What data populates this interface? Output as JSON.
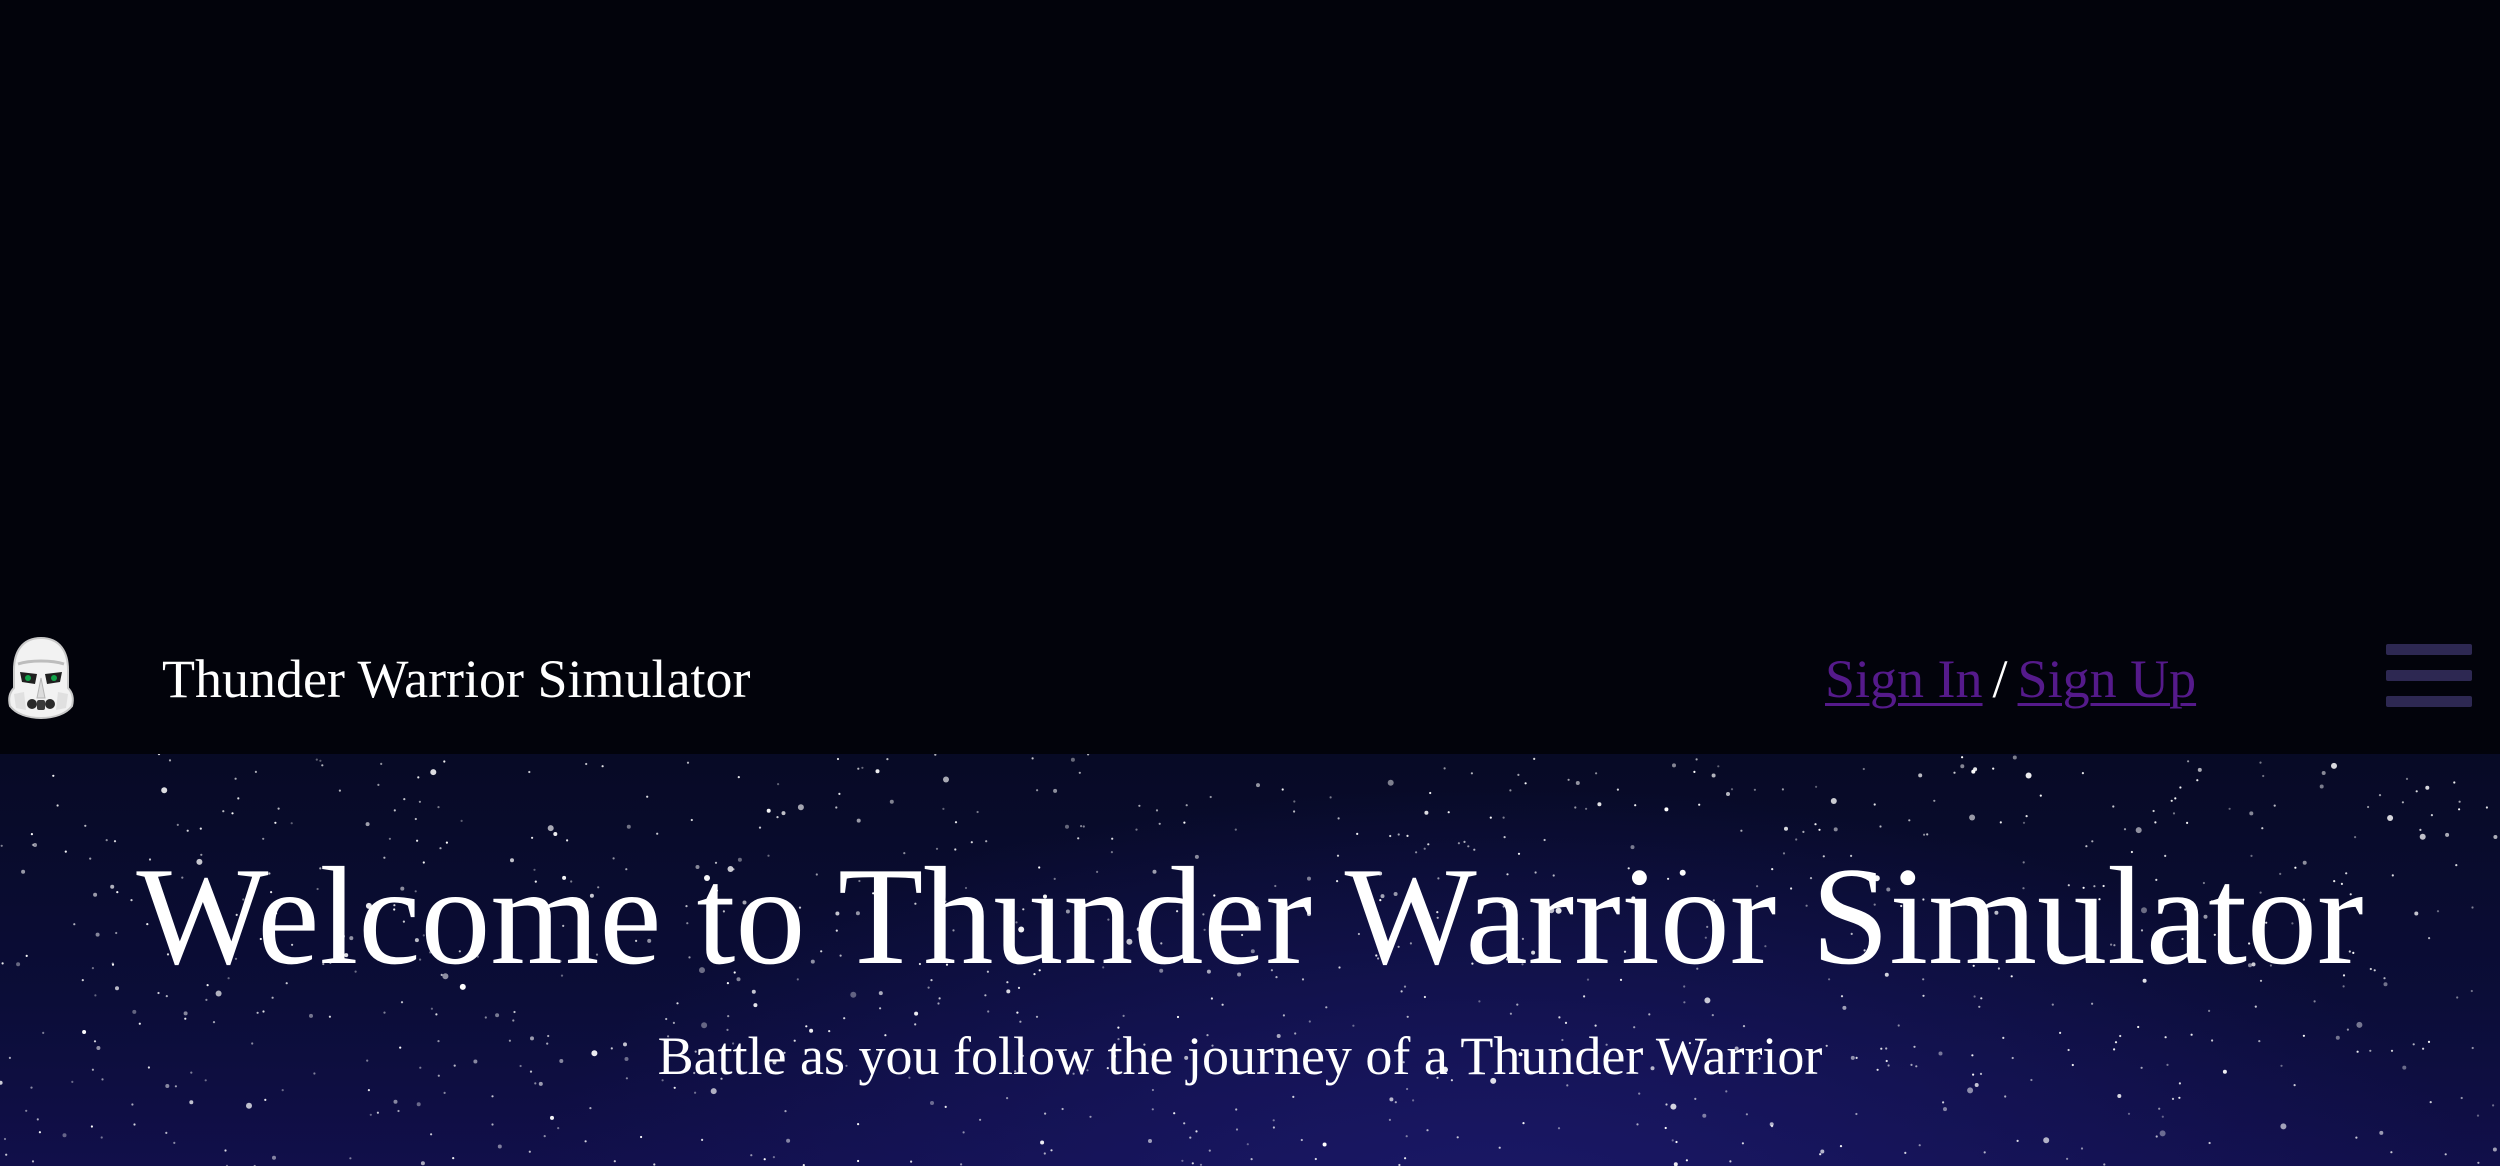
{
  "navbar": {
    "logo_icon": "stormtrooper-helmet-icon",
    "brand": "Thunder Warrior Simulator",
    "sign_in": "Sign In",
    "separator": "/",
    "sign_up": "Sign Up",
    "menu_icon": "hamburger-menu-icon"
  },
  "hero": {
    "title": "Welcome to Thunder Warrior Simulator",
    "subtitle": "Battle as you follow the journey of a Thunder Warrior"
  },
  "colors": {
    "background": "#02030b",
    "link": "#551a8b",
    "menu_icon": "#2d2852",
    "text": "#ffffff"
  }
}
